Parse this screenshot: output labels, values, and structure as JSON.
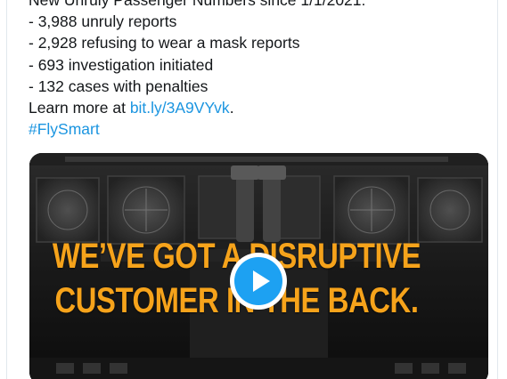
{
  "tweet": {
    "lines": [
      "New Unruly Passenger Numbers since 1/1/2021:",
      "- 3,988 unruly reports",
      "- 2,928 refusing to wear a mask reports",
      "- 693 investigation initiated",
      "- 132 cases with penalties"
    ],
    "learn_more_prefix": "Learn more at ",
    "link_text": "bit.ly/3A9VYvk",
    "learn_more_suffix": ".",
    "hashtag": "#FlySmart"
  },
  "media": {
    "headline_line1": "WE’VE GOT A DISRUPTIVE",
    "headline_line2": "CUSTOMER IN THE BACK.",
    "play_icon": "play-icon",
    "colors": {
      "headline": "#f6a31b",
      "play_button": "#1da1f2"
    }
  }
}
